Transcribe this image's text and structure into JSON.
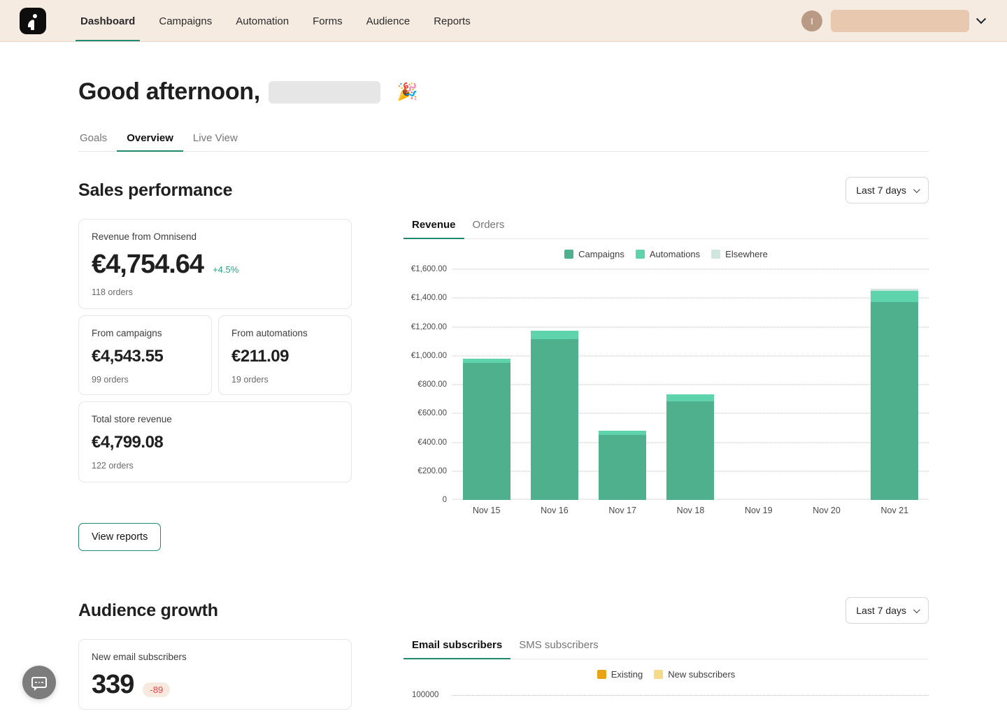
{
  "topnav": {
    "logo_icon": "omnisend-logo-icon",
    "links": [
      {
        "label": "Dashboard",
        "active": true
      },
      {
        "label": "Campaigns",
        "active": false
      },
      {
        "label": "Automation",
        "active": false
      },
      {
        "label": "Forms",
        "active": false
      },
      {
        "label": "Audience",
        "active": false
      },
      {
        "label": "Reports",
        "active": false
      }
    ],
    "avatar_initial": "I",
    "account_name_redacted": "",
    "account_chevron_icon": "chevron-down-icon"
  },
  "greeting": {
    "text": "Good afternoon,",
    "name_redacted": "",
    "emoji": "🎉"
  },
  "page_tabs": [
    {
      "label": "Goals",
      "active": false
    },
    {
      "label": "Overview",
      "active": true
    },
    {
      "label": "Live View",
      "active": false
    }
  ],
  "sales": {
    "title": "Sales performance",
    "range_label": "Last 7 days",
    "range_caret_icon": "chevron-down-icon",
    "cards": {
      "primary": {
        "label": "Revenue from Omnisend",
        "value": "€4,754.64",
        "delta": "+4.5%",
        "orders": "118 orders"
      },
      "campaigns": {
        "label": "From campaigns",
        "value": "€4,543.55",
        "orders": "99 orders"
      },
      "automations": {
        "label": "From automations",
        "value": "€211.09",
        "orders": "19 orders"
      },
      "total": {
        "label": "Total store revenue",
        "value": "€4,799.08",
        "orders": "122 orders"
      }
    },
    "view_reports_label": "View reports",
    "chart_tabs": [
      {
        "label": "Revenue",
        "active": true
      },
      {
        "label": "Orders",
        "active": false
      }
    ]
  },
  "audience": {
    "title": "Audience growth",
    "range_label": "Last 7 days",
    "range_caret_icon": "chevron-down-icon",
    "card": {
      "label": "New email subscribers",
      "value": "339",
      "delta": "-89"
    },
    "chart_tabs": [
      {
        "label": "Email subscribers",
        "active": true
      },
      {
        "label": "SMS subscribers",
        "active": false
      }
    ],
    "legend": [
      {
        "label": "Existing",
        "color": "#e8a317"
      },
      {
        "label": "New subscribers",
        "color": "#f7d98a"
      }
    ],
    "first_ytick": "100000"
  },
  "chat_widget": {
    "icon": "chat-bubble-icon"
  },
  "colors": {
    "brand_green": "#1f8a70",
    "campaigns": "#4fb08d",
    "automations": "#5fd3ab",
    "elsewhere": "#cfe6e0",
    "nav_bg": "#f5ebe1",
    "delta_positive": "#2aa083",
    "delta_negative": "#e8464a"
  },
  "chart_data": {
    "type": "bar",
    "title": "Revenue",
    "stacked": true,
    "grid": true,
    "legend_position": "top-center",
    "xlabel": "",
    "ylabel": "",
    "ylim": [
      0,
      1600
    ],
    "yticks": [
      0,
      200,
      400,
      600,
      800,
      1000,
      1200,
      1400,
      1600
    ],
    "ytick_labels": [
      "0",
      "€200.00",
      "€400.00",
      "€600.00",
      "€800.00",
      "€1,000.00",
      "€1,200.00",
      "€1,400.00",
      "€1,600.00"
    ],
    "categories": [
      "Nov 15",
      "Nov 16",
      "Nov 17",
      "Nov 18",
      "Nov 19",
      "Nov 20",
      "Nov 21"
    ],
    "series": [
      {
        "name": "Campaigns",
        "color": "#4fb08d",
        "values": [
          950,
          1115,
          450,
          685,
          0,
          0,
          1370
        ]
      },
      {
        "name": "Automations",
        "color": "#5fd3ab",
        "values": [
          28,
          60,
          28,
          45,
          0,
          0,
          80
        ]
      },
      {
        "name": "Elsewhere",
        "color": "#cfe6e0",
        "values": [
          0,
          0,
          0,
          0,
          0,
          0,
          12
        ]
      }
    ],
    "totals": [
      978,
      1175,
      478,
      730,
      0,
      0,
      1462
    ]
  }
}
